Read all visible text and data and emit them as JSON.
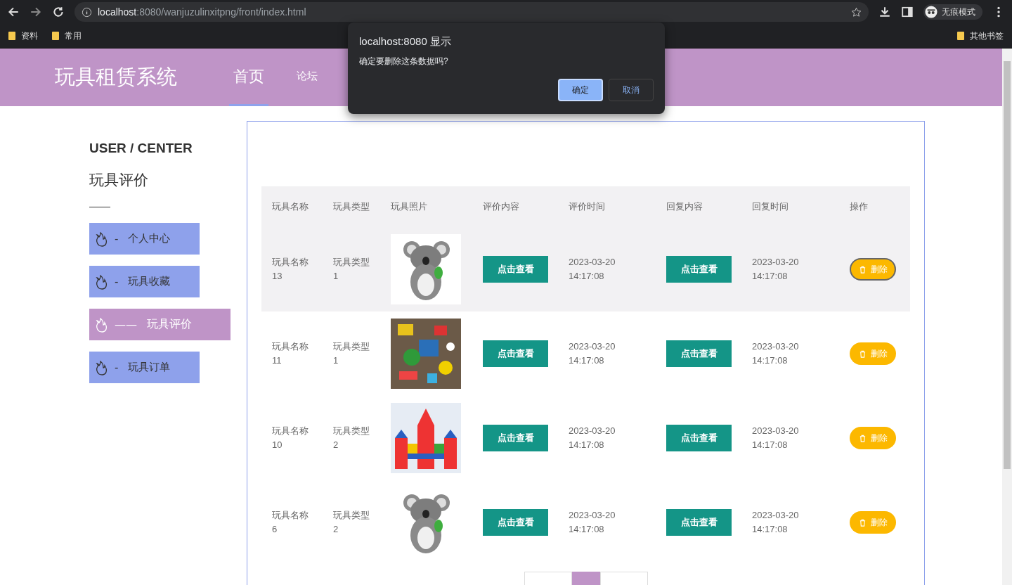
{
  "browser": {
    "url_host": "localhost",
    "url_rest": ":8080/wanjuzulinxitpng/front/index.html",
    "profile": "无痕模式",
    "bookmarks": [
      "资料",
      "常用"
    ],
    "other_bookmarks": "其他书签"
  },
  "dialog": {
    "title": "localhost:8080 显示",
    "message": "确定要删除这条数据吗?",
    "buttons": [
      {
        "label": "确定",
        "selected": true
      },
      {
        "label": "取消",
        "selected": false
      }
    ]
  },
  "nav": {
    "brand": "玩具租赁系统",
    "items": [
      {
        "label": "首页",
        "selected": true
      },
      {
        "label": "论坛",
        "selected": false
      }
    ]
  },
  "sidebar": {
    "heading": "USER / CENTER",
    "title": "玩具评价",
    "items": [
      {
        "dash": "-",
        "label": "个人中心",
        "selected": false
      },
      {
        "dash": "-",
        "label": "玩具收藏",
        "selected": false
      },
      {
        "dash": "——",
        "label": "玩具评价",
        "selected": true
      },
      {
        "dash": "-",
        "label": "玩具订单",
        "selected": false
      }
    ]
  },
  "table": {
    "columns": [
      "玩具名称",
      "玩具类型",
      "玩具照片",
      "评价内容",
      "评价时间",
      "回复内容",
      "回复时间",
      "操作"
    ],
    "rows": [
      {
        "name": "玩具名称13",
        "type": "玩具类型1",
        "review": "点击查看",
        "review_time": "2023-03-20 14:17:08",
        "reply": "点击查看",
        "reply_time": "2023-03-20 14:17:08",
        "action": "删除",
        "highlighted": true
      },
      {
        "name": "玩具名称11",
        "type": "玩具类型1",
        "review": "点击查看",
        "review_time": "2023-03-20 14:17:08",
        "reply": "点击查看",
        "reply_time": "2023-03-20 14:17:08",
        "action": "删除",
        "highlighted": false
      },
      {
        "name": "玩具名称10",
        "type": "玩具类型2",
        "review": "点击查看",
        "review_time": "2023-03-20 14:17:08",
        "reply": "点击查看",
        "reply_time": "2023-03-20 14:17:08",
        "action": "删除",
        "highlighted": false
      },
      {
        "name": "玩具名称6",
        "type": "玩具类型2",
        "review": "点击查看",
        "review_time": "2023-03-20 14:17:08",
        "reply": "点击查看",
        "reply_time": "2023-03-20 14:17:08",
        "action": "删除",
        "highlighted": false
      }
    ]
  },
  "pagination": [
    {
      "selected": false
    },
    {
      "selected": true
    },
    {
      "selected": false
    }
  ]
}
